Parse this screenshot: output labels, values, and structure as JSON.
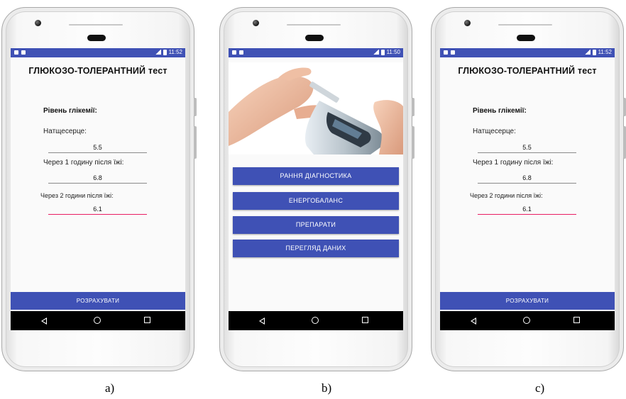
{
  "screens": {
    "a": {
      "status_time": "11:52",
      "title": "ГЛЮКОЗО-ТОЛЕРАНТНИЙ тест",
      "glycemia_label": "Рівень глікемії:",
      "fasting_label": "Натщесерце:",
      "fasting_value": "5.5",
      "hour1_label": "Через 1 годину після їжі:",
      "hour1_value": "6.8",
      "hour2_label": "Через 2 години після їжі:",
      "hour2_value": "6.1",
      "calculate_label": "РОЗРАХУВАТИ"
    },
    "b": {
      "status_time": "11:50",
      "menu": [
        "РАННЯ ДІАГНОСТИКА",
        "ЕНЕРГОБАЛАНС",
        "ПРЕПАРАТИ",
        "ПЕРЕГЛЯД ДАНИХ"
      ]
    },
    "c": {
      "status_time": "11:52",
      "title": "ГЛЮКОЗО-ТОЛЕРАНТНИЙ тест",
      "glycemia_label": "Рівень глікемії:",
      "fasting_label": "Натщесерце:",
      "fasting_value": "5.5",
      "hour1_label": "Через 1 годину після їжі:",
      "hour1_value": "6.8",
      "hour2_label": "Через 2 години після їжі:",
      "hour2_value": "6.1",
      "calculate_label": "РОЗРАХУВАТИ"
    }
  },
  "captions": [
    "a)",
    "b)",
    "c)"
  ],
  "colors": {
    "primary": "#3f51b5",
    "accent": "#e91e63",
    "nav": "#000000"
  }
}
